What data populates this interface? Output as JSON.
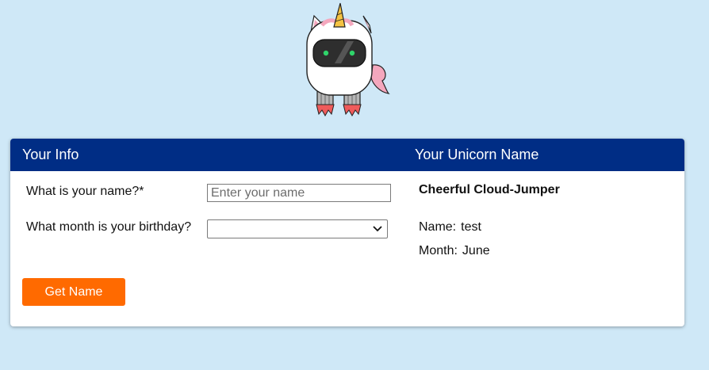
{
  "mascot": {
    "icon": "unicorn-robot-icon"
  },
  "left_panel": {
    "heading": "Your Info",
    "name_label": "What is your name?*",
    "name_placeholder": "Enter your name",
    "name_value": "",
    "month_label": "What month is your birthday?",
    "month_selected": "",
    "button_label": "Get Name"
  },
  "right_panel": {
    "heading": "Your Unicorn Name",
    "unicorn_name": "Cheerful Cloud-Jumper",
    "name_key": "Name:",
    "name_value": "test",
    "month_key": "Month:",
    "month_value": "June"
  },
  "colors": {
    "background": "#cfe8f7",
    "header": "#002d85",
    "button": "#ff6a00"
  }
}
